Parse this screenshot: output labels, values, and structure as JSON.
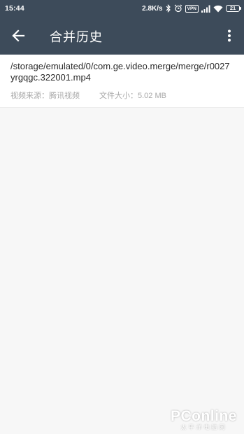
{
  "status_bar": {
    "time": "15:44",
    "net_speed": "2.8K/s",
    "vpn_label": "VPN",
    "battery_level": "21",
    "icons": [
      "bluetooth-icon",
      "alarm-icon",
      "vpn-icon",
      "signal-icon",
      "wifi-icon",
      "battery-icon"
    ]
  },
  "toolbar": {
    "back_icon": "arrow-left-icon",
    "title": "合并历史",
    "menu_icon": "more-vert-icon",
    "background_color": "#3d4b5a"
  },
  "history": {
    "items": [
      {
        "path": "/storage/emulated/0/com.ge.video.merge/merge/r0027yrgqgc.322001.mp4",
        "source": "视频来源：腾讯视频",
        "size": "文件大小：5.02 MB"
      }
    ]
  },
  "watermark": {
    "brand": "PConline",
    "sub": "太平洋电脑网"
  }
}
